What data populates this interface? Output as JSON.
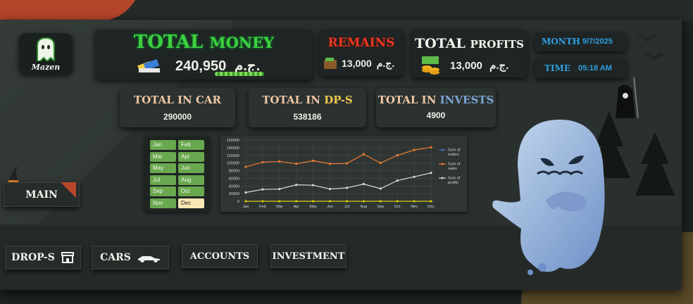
{
  "logo": {
    "name": "Mazen"
  },
  "total_money": {
    "title_a": "TOTAL",
    "title_b": "MONEY",
    "value": "240,950",
    "currency": "ج.م."
  },
  "remains": {
    "title": "REMAINS",
    "value": "13,000",
    "currency": "ج.م."
  },
  "total_profits": {
    "title_a": "TOTAL",
    "title_b": "PROFITS",
    "value": "13,000",
    "currency": "ج.م."
  },
  "month": {
    "label": "MONTH",
    "value": "9/7/2025"
  },
  "time": {
    "label": "TIME",
    "value": "05:18 AM"
  },
  "kpis": [
    {
      "pre": "TOTAL IN",
      "name": "CAR",
      "value": "290000",
      "color": "#f2c7a5"
    },
    {
      "pre": "TOTAL IN",
      "name": "DP-S",
      "value": "538186",
      "color": "#f2c94c"
    },
    {
      "pre": "TOTAL IN",
      "name": "INVESTS",
      "value": "4900",
      "color": "#7ea6d8"
    }
  ],
  "nav": {
    "main": "MAIN",
    "drops": "DROP-S",
    "cars": "CARS",
    "accounts": "ACCOUNTS",
    "investment": "INVESTMENT"
  },
  "months": [
    "Jan",
    "Feb",
    "Mar",
    "Apr",
    "May",
    "Jun",
    "Jul",
    "Aug",
    "Sep",
    "Oct",
    "Nov",
    "Dec"
  ],
  "selected_month": "Dec",
  "colors": {
    "accent_green": "#3fbf3f",
    "accent_red": "#d23a2a",
    "month_btn": "#6aa84f",
    "month_sel": "#f9e7b3"
  },
  "chart_data": {
    "type": "line",
    "categories": [
      "Jan",
      "Feb",
      "Mar",
      "Apr",
      "May",
      "Jun",
      "Jul",
      "Aug",
      "Sep",
      "Oct",
      "Nov",
      "Dec"
    ],
    "ylim": [
      0,
      160000
    ],
    "yticks": [
      "0",
      "20000",
      "40000",
      "60000",
      "80000",
      "100000",
      "120000",
      "140000",
      "160000"
    ],
    "series": [
      {
        "name": "Sum of orders",
        "color": "#4472c4",
        "values": [
          0,
          0,
          0,
          0,
          0,
          0,
          0,
          0,
          0,
          0,
          0,
          0
        ]
      },
      {
        "name": "Sum of sales",
        "color": "#ed7d31",
        "values": [
          90000,
          102000,
          104000,
          98000,
          106000,
          98000,
          99000,
          123000,
          100000,
          120000,
          134000,
          141000
        ]
      },
      {
        "name": "Sum of profits",
        "color": "#d8d8d8",
        "values": [
          23000,
          31000,
          32000,
          43000,
          42000,
          32000,
          35000,
          45000,
          33000,
          54000,
          64000,
          74000
        ]
      },
      {
        "name": "",
        "color": "#d4c400",
        "values": [
          0,
          0,
          0,
          0,
          0,
          0,
          0,
          0,
          0,
          0,
          0,
          0
        ]
      }
    ]
  }
}
